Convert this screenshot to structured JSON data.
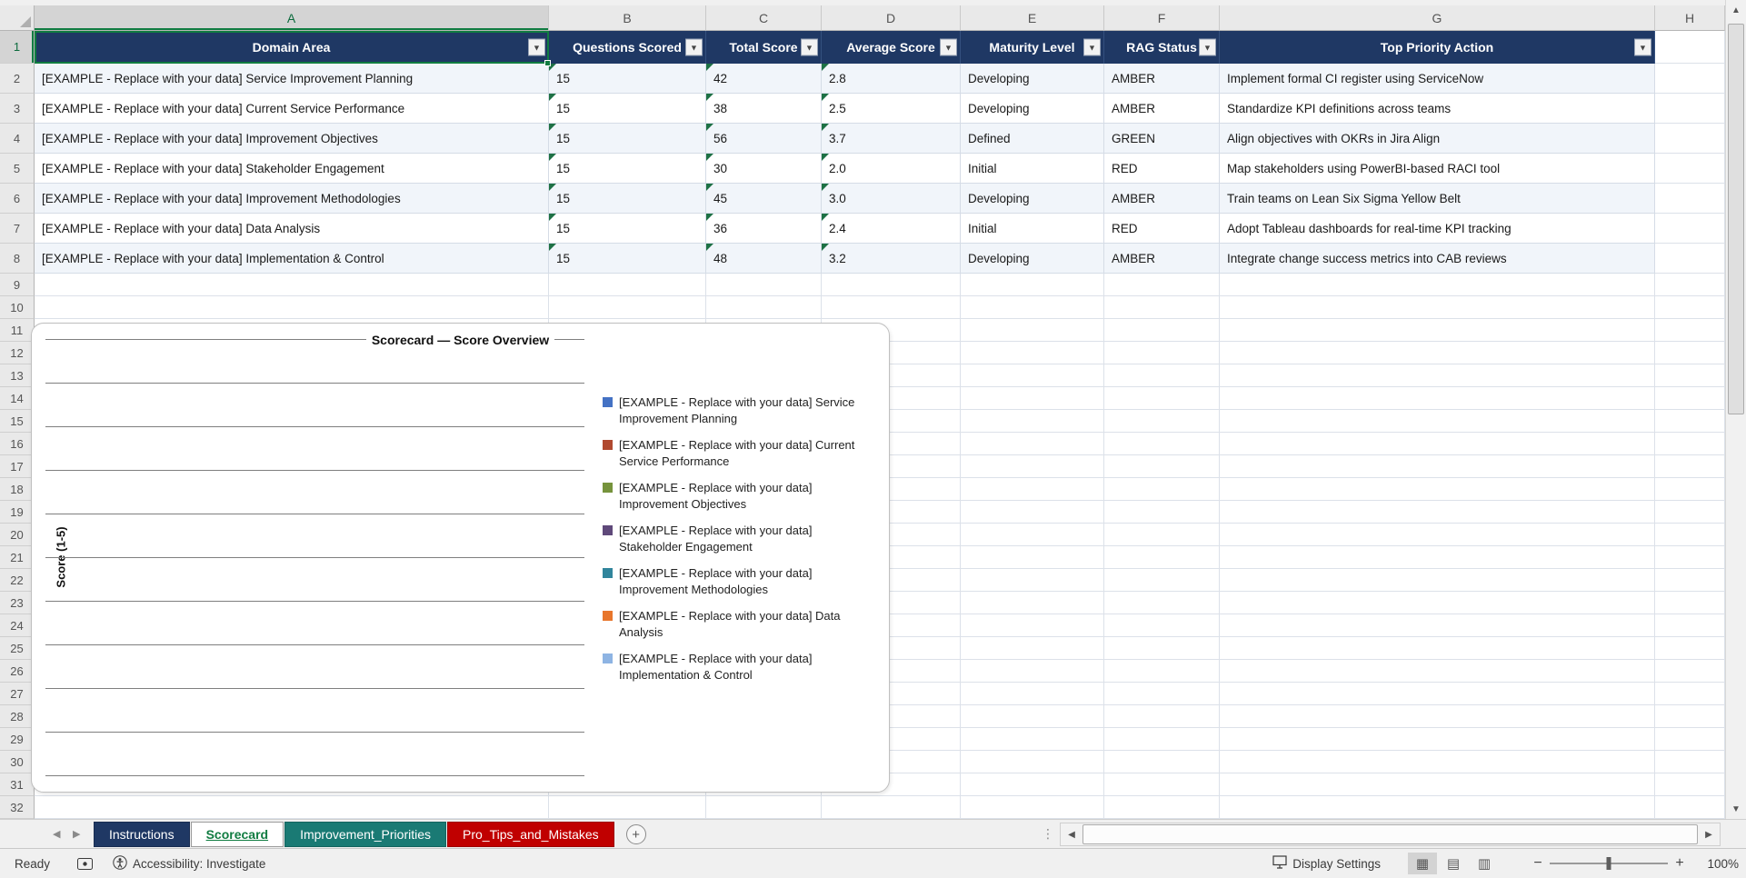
{
  "grid": {
    "columns": [
      "A",
      "B",
      "C",
      "D",
      "E",
      "F",
      "G",
      "H"
    ],
    "row_count": 32,
    "selected_cell": "A1",
    "selected_column": "A",
    "selected_row": "1"
  },
  "table": {
    "headers": [
      "Domain Area",
      "Questions Scored",
      "Total Score",
      "Average Score",
      "Maturity Level",
      "RAG Status",
      "Top Priority Action"
    ],
    "rows": [
      [
        "[EXAMPLE - Replace with your data] Service Improvement Planning",
        "15",
        "42",
        "2.8",
        "Developing",
        "AMBER",
        "Implement formal CI register using ServiceNow"
      ],
      [
        "[EXAMPLE - Replace with your data] Current Service Performance",
        "15",
        "38",
        "2.5",
        "Developing",
        "AMBER",
        "Standardize KPI definitions across teams"
      ],
      [
        "[EXAMPLE - Replace with your data] Improvement Objectives",
        "15",
        "56",
        "3.7",
        "Defined",
        "GREEN",
        "Align objectives with OKRs in Jira Align"
      ],
      [
        "[EXAMPLE - Replace with your data] Stakeholder Engagement",
        "15",
        "30",
        "2.0",
        "Initial",
        "RED",
        "Map stakeholders using PowerBI-based RACI tool"
      ],
      [
        "[EXAMPLE - Replace with your data] Improvement Methodologies",
        "15",
        "45",
        "3.0",
        "Developing",
        "AMBER",
        "Train teams on Lean Six Sigma Yellow Belt"
      ],
      [
        "[EXAMPLE - Replace with your data] Data Analysis",
        "15",
        "36",
        "2.4",
        "Initial",
        "RED",
        "Adopt Tableau dashboards for real-time KPI tracking"
      ],
      [
        "[EXAMPLE - Replace with your data] Implementation & Control",
        "15",
        "48",
        "3.2",
        "Developing",
        "AMBER",
        "Integrate change success metrics into CAB reviews"
      ]
    ]
  },
  "chart": {
    "title": "Scorecard — Score Overview",
    "y_axis_label": "Score (1-5)",
    "gridline_count": 11,
    "legend": [
      {
        "label": "[EXAMPLE - Replace with your data] Service Improvement Planning",
        "color": "#4472C4"
      },
      {
        "label": "[EXAMPLE - Replace with your data] Current Service Performance",
        "color": "#B0492F"
      },
      {
        "label": "[EXAMPLE - Replace with your data] Improvement Objectives",
        "color": "#76933C"
      },
      {
        "label": "[EXAMPLE - Replace with your data] Stakeholder Engagement",
        "color": "#5F497A"
      },
      {
        "label": "[EXAMPLE - Replace with your data] Improvement Methodologies",
        "color": "#31859C"
      },
      {
        "label": "[EXAMPLE - Replace with your data] Data Analysis",
        "color": "#E8762C"
      },
      {
        "label": "[EXAMPLE - Replace with your data] Implementation & Control",
        "color": "#8EB4E3"
      }
    ]
  },
  "sheet_tabs": [
    {
      "label": "Instructions",
      "bg": "#1F3864",
      "fg": "#FFFFFF",
      "active": false
    },
    {
      "label": "Scorecard",
      "bg": "#FFFFFF",
      "fg": "#107C41",
      "active": true
    },
    {
      "label": "Improvement_Priorities",
      "bg": "#1A7A74",
      "fg": "#FFFFFF",
      "active": false
    },
    {
      "label": "Pro_Tips_and_Mistakes",
      "bg": "#C00000",
      "fg": "#FFFFFF",
      "active": false
    }
  ],
  "status_bar": {
    "mode": "Ready",
    "accessibility": "Accessibility: Investigate",
    "display_settings": "Display Settings",
    "zoom_level": "100%"
  },
  "icons": {
    "filter": "▼",
    "up": "▲",
    "down": "▼",
    "left": "◀",
    "right": "▶",
    "views": [
      "▦",
      "▤",
      "▥"
    ],
    "zoom_out": "−",
    "zoom_in": "+",
    "new_sheet": "+",
    "gripper": "⋮"
  },
  "colors": {
    "table_header_bg": "#1F3864",
    "selection_green": "#107C41",
    "error_triangle_green": "#1E7145"
  }
}
